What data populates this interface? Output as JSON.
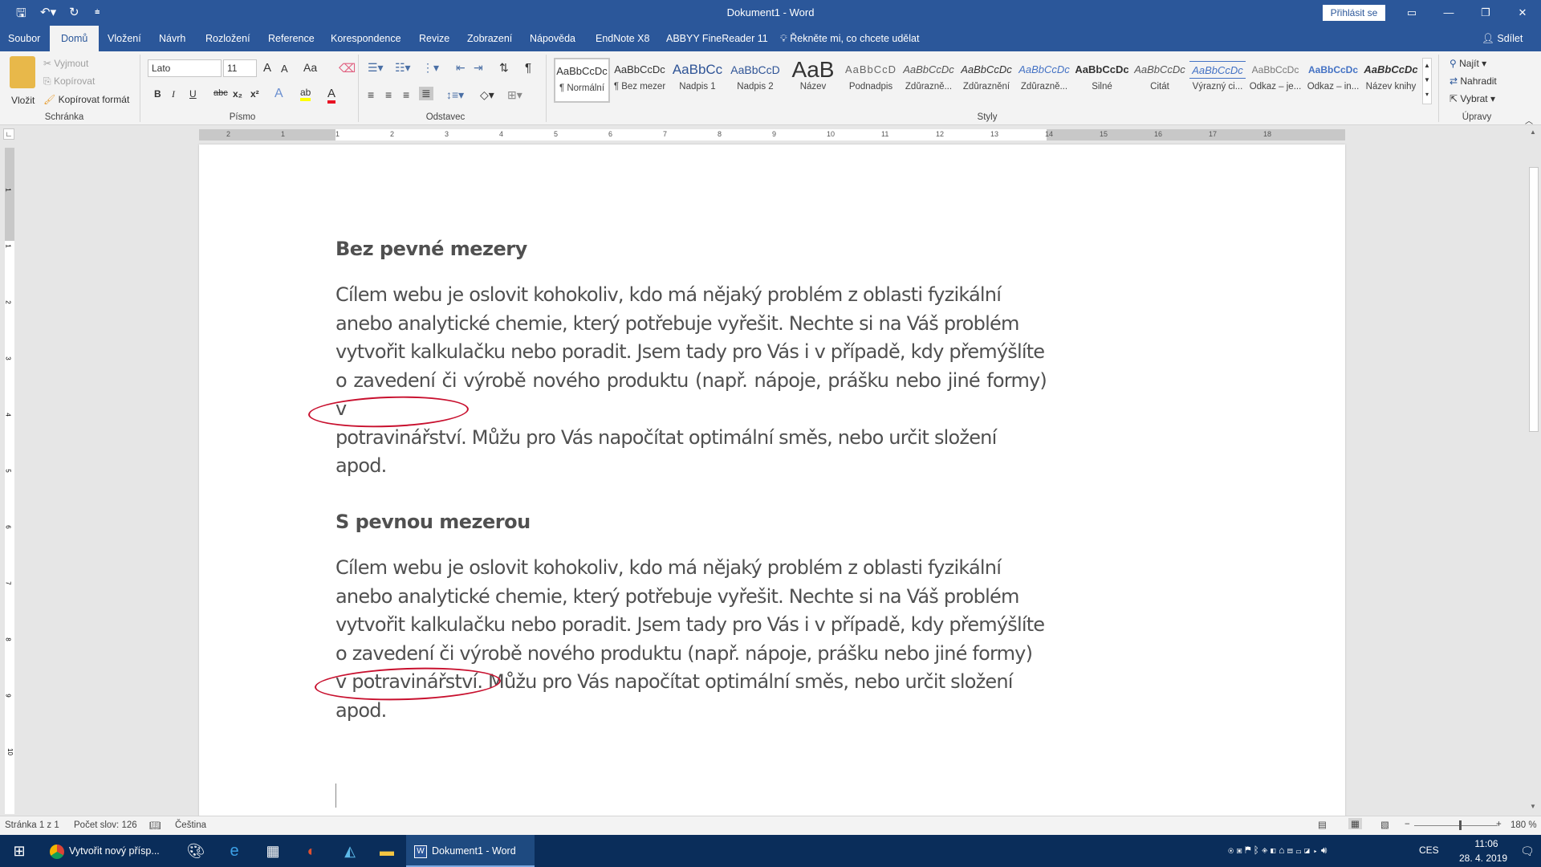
{
  "window": {
    "title": "Dokument1  -  Word",
    "signin_label": "Přihlásit se",
    "controls": {
      "ribbon_display": "▭",
      "minimize": "—",
      "restore": "❐",
      "close": "✕"
    }
  },
  "qat": {
    "save": "save-icon",
    "undo": "undo-icon",
    "redo": "redo-icon",
    "customize": "customize-icon"
  },
  "tabs": [
    {
      "label": "Soubor",
      "active": false
    },
    {
      "label": "Domů",
      "active": true
    },
    {
      "label": "Vložení",
      "active": false
    },
    {
      "label": "Návrh",
      "active": false
    },
    {
      "label": "Rozložení",
      "active": false
    },
    {
      "label": "Reference",
      "active": false
    },
    {
      "label": "Korespondence",
      "active": false
    },
    {
      "label": "Revize",
      "active": false
    },
    {
      "label": "Zobrazení",
      "active": false
    },
    {
      "label": "Nápověda",
      "active": false
    },
    {
      "label": "EndNote X8",
      "active": false
    },
    {
      "label": "ABBYY FineReader 11",
      "active": false
    }
  ],
  "tell_me": {
    "placeholder": "Řekněte mi, co chcete udělat"
  },
  "share_label": "Sdílet",
  "ribbon": {
    "clipboard": {
      "group_label": "Schránka",
      "paste": "Vložit",
      "cut": "Vyjmout",
      "copy": "Kopírovat",
      "format_painter": "Kopírovat formát"
    },
    "font": {
      "group_label": "Písmo",
      "font_name": "Lato",
      "font_size": "11",
      "grow": "A",
      "shrink": "A",
      "change_case": "Aa",
      "bold": "B",
      "italic": "I",
      "underline": "U",
      "strike": "abc",
      "subscript": "x₂",
      "superscript": "x²",
      "text_effects": "A",
      "highlight": "ab",
      "font_color": "A",
      "highlight_color": "#ffff00",
      "font_color_value": "#e81123"
    },
    "paragraph": {
      "group_label": "Odstavec",
      "pilcrow": "¶"
    },
    "styles": {
      "group_label": "Styly",
      "items": [
        {
          "preview": "AaBbCcDc",
          "name": "¶ Normální"
        },
        {
          "preview": "AaBbCcDc",
          "name": "¶ Bez mezer"
        },
        {
          "preview": "AaBbCc",
          "name": "Nadpis 1"
        },
        {
          "preview": "AaBbCcD",
          "name": "Nadpis 2"
        },
        {
          "preview": "AaB",
          "name": "Název"
        },
        {
          "preview": "AaBbCcD",
          "name": "Podnadpis"
        },
        {
          "preview": "AaBbCcDc",
          "name": "Zdůrazně..."
        },
        {
          "preview": "AaBbCcDc",
          "name": "Zdůraznění"
        },
        {
          "preview": "AaBbCcDc",
          "name": "Zdůrazně..."
        },
        {
          "preview": "AaBbCcDc",
          "name": "Silné"
        },
        {
          "preview": "AaBbCcDc",
          "name": "Citát"
        },
        {
          "preview": "AaBbCcDc",
          "name": "Výrazný ci..."
        },
        {
          "preview": "AaBbCcDc",
          "name": "Odkaz – je..."
        },
        {
          "preview": "AaBbCcDc",
          "name": "Odkaz – in..."
        },
        {
          "preview": "AaBbCcDc",
          "name": "Název knihy"
        }
      ]
    },
    "editing": {
      "group_label": "Úpravy",
      "find": "Najít",
      "replace": "Nahradit",
      "select": "Vybrat"
    }
  },
  "ruler": {
    "h_ticks": [
      "2",
      "1",
      "1",
      "2",
      "3",
      "4",
      "5",
      "6",
      "7",
      "8",
      "9",
      "10",
      "11",
      "12",
      "13",
      "14",
      "15",
      "16",
      "17",
      "18"
    ],
    "v_ticks": [
      "1",
      "1",
      "2",
      "3",
      "4",
      "5",
      "6",
      "7",
      "8",
      "9",
      "10"
    ]
  },
  "document": {
    "section1": {
      "heading": "Bez pevné mezery",
      "lines": [
        "Cílem webu je oslovit kohokoliv, kdo má nějaký problém z oblasti fyzikální",
        "anebo analytické chemie, který potřebuje vyřešit. Nechte si na Váš problém",
        "vytvořit kalkulačku nebo poradit. Jsem tady pro Vás i v případě, kdy přemýšlíte",
        "o zavedení či výrobě nového produktu (např. nápoje, prášku nebo jiné formy) v",
        "potravinářství. Můžu pro Vás napočítat optimální směs, nebo určit složení",
        "apod."
      ]
    },
    "section2": {
      "heading": "S pevnou mezerou",
      "lines": [
        "Cílem webu je oslovit kohokoliv, kdo má nějaký problém z oblasti fyzikální",
        "anebo analytické chemie, který potřebuje vyřešit. Nechte si na Váš problém",
        "vytvořit kalkulačku nebo poradit. Jsem tady pro Vás i v případě, kdy přemýšlíte",
        "o zavedení či výrobě nového produktu (např. nápoje, prášku nebo jiné formy)",
        "v potravinářství. Můžu pro Vás napočítat optimální směs, nebo určit složení",
        "apod."
      ]
    },
    "annotation_color": "#c8102e"
  },
  "statusbar": {
    "page": "Stránka 1 z 1",
    "words": "Počet slov: 126",
    "language": "Čeština",
    "zoom": "180 %",
    "zoom_minus": "−",
    "zoom_plus": "+"
  },
  "taskbar": {
    "start": "windows-icon",
    "chrome_title": "Vytvořit nový přísp...",
    "word_title": "Dokument1 - Word",
    "lang": "CES",
    "time": "11:06",
    "date": "28. 4. 2019"
  }
}
